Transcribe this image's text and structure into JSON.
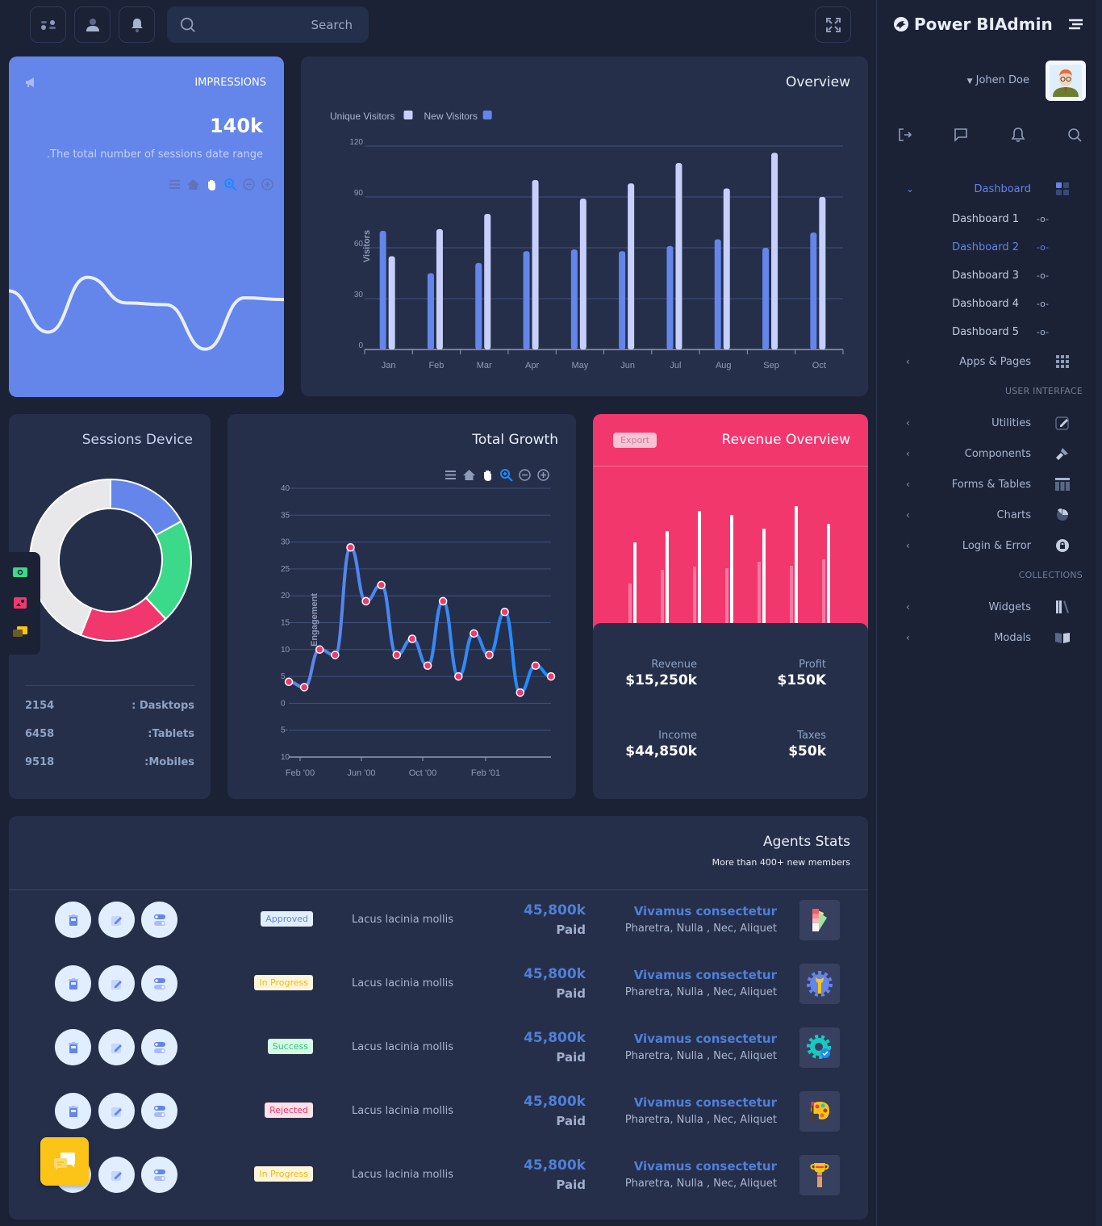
{
  "topbar": {
    "search_placeholder": "Search",
    "icons": [
      "apps-icon",
      "user-icon",
      "bell-icon",
      "search-icon",
      "fullscreen-icon"
    ]
  },
  "impressions": {
    "title": "IMPRESSIONS",
    "value": "140k",
    "subtitle": ".The total number of sessions date range",
    "sparkline": [
      62,
      38,
      70,
      55,
      54,
      28,
      58,
      57
    ]
  },
  "overview": {
    "title": "Overview",
    "chart_data": {
      "type": "bar",
      "title": "Overview",
      "xlabel": "",
      "ylabel": "Visitors",
      "ylim": [
        0,
        120
      ],
      "yticks": [
        0,
        30,
        60,
        90,
        120
      ],
      "legend": "top-left",
      "categories": [
        "Jan",
        "Feb",
        "Mar",
        "Apr",
        "May",
        "Jun",
        "Jul",
        "Aug",
        "Sep",
        "Oct"
      ],
      "series": [
        {
          "name": "New Visitors",
          "color": "#6485ea",
          "values": [
            70,
            45,
            51,
            58,
            59,
            58,
            61,
            65,
            60,
            69
          ]
        },
        {
          "name": "Unique Visitors",
          "color": "#c7d0fb",
          "values": [
            55,
            71,
            80,
            100,
            89,
            98,
            110,
            95,
            116,
            90
          ]
        }
      ],
      "legend_labels": [
        "Unique Visitors",
        "New Visitors"
      ]
    }
  },
  "sessions": {
    "title": "Sessions Device",
    "chart_data": {
      "type": "pie",
      "slices": [
        {
          "name": "Blue",
          "value": 17,
          "color": "#6485ea"
        },
        {
          "name": "Green",
          "value": 21,
          "color": "#3bd98a"
        },
        {
          "name": "Red",
          "value": 18,
          "color": "#f2376d"
        },
        {
          "name": "Grey",
          "value": 44,
          "color": "#e8e8ea"
        }
      ]
    },
    "rows": [
      {
        "value": "2154",
        "label": ": Dasktops"
      },
      {
        "value": "6458",
        "label": ":Tablets"
      },
      {
        "value": "9518",
        "label": ":Mobiles"
      }
    ]
  },
  "growth": {
    "title": "Total Growth",
    "chart_data": {
      "type": "line",
      "title": "Total Growth",
      "ylabel": "Engagement",
      "ylim": [
        -10,
        40
      ],
      "ytick_labels": [
        "40",
        "35",
        "30",
        "25",
        "20",
        "15",
        "10",
        "5",
        "0",
        "5-",
        "10-"
      ],
      "xtick_labels": [
        "Feb '00",
        "Jun '00",
        "Oct '00",
        "Feb '01"
      ],
      "values": [
        4,
        3,
        10,
        9,
        29,
        19,
        22,
        9,
        12,
        7,
        19,
        5,
        13,
        9,
        17,
        2,
        7,
        5
      ],
      "grid": true
    }
  },
  "revenue": {
    "title": "Revenue Overview",
    "export_label": "Export",
    "chart_data": {
      "type": "bar",
      "series": [
        {
          "name": "primary",
          "values": [
            95,
            109,
            134,
            129,
            112,
            140,
            118
          ]
        },
        {
          "name": "secondary",
          "values": [
            44,
            61,
            65,
            63,
            71,
            66,
            74
          ]
        }
      ]
    },
    "stats": [
      {
        "label": "Revenue",
        "value": "$15,250k"
      },
      {
        "label": "Profit",
        "value": "$150K"
      },
      {
        "label": "Income",
        "value": "$44,850k"
      },
      {
        "label": "Taxes",
        "value": "$50k"
      }
    ]
  },
  "agents": {
    "title": "Agents Stats",
    "subtitle": "More than 400+ new members",
    "rows": [
      {
        "status": "Approved",
        "desc": "Lacus lacinia mollis",
        "amount": "45,800k",
        "paid": "Paid",
        "title": "Vivamus consectetur",
        "sub": "Pharetra, Nulla , Nec, Aliquet",
        "thumb": "palette-swatch-icon"
      },
      {
        "status": "In Progress",
        "desc": "Lacus lacinia mollis",
        "amount": "45,800k",
        "paid": "Paid",
        "title": "Vivamus consectetur",
        "sub": "Pharetra, Nulla , Nec, Aliquet",
        "thumb": "gear-wrench-icon"
      },
      {
        "status": "Success",
        "desc": "Lacus lacinia mollis",
        "amount": "45,800k",
        "paid": "Paid",
        "title": "Vivamus consectetur",
        "sub": "Pharetra, Nulla , Nec, Aliquet",
        "thumb": "gear-check-icon"
      },
      {
        "status": "Rejected",
        "desc": "Lacus lacinia mollis",
        "amount": "45,800k",
        "paid": "Paid",
        "title": "Vivamus consectetur",
        "sub": "Pharetra, Nulla , Nec, Aliquet",
        "thumb": "paint-palette-icon"
      },
      {
        "status": "In Progress",
        "desc": "Lacus lacinia mollis",
        "amount": "45,800k",
        "paid": "Paid",
        "title": "Vivamus consectetur",
        "sub": "Pharetra, Nulla , Nec, Aliquet",
        "thumb": "trophy-icon"
      }
    ],
    "status_colors": {
      "Approved": {
        "bg": "#e1eeff",
        "fg": "#6485ea"
      },
      "In Progress": {
        "bg": "#fff5da",
        "fg": "#f4b80f"
      },
      "Success": {
        "bg": "#d6fbe5",
        "fg": "#2ec27a"
      },
      "Rejected": {
        "bg": "#fde1e8",
        "fg": "#f2376d"
      }
    }
  },
  "sidebar": {
    "brand": "Power BIAdmin",
    "user_name": "Johen Doe",
    "dashboard_label": "Dashboard",
    "dashboards": [
      "Dashboard 1",
      "Dashboard 2",
      "Dashboard 3",
      "Dashboard 4",
      "Dashboard 5"
    ],
    "active_dashboard": "Dashboard 2",
    "apps_label": "Apps & Pages",
    "section_ui": "USER INTERFACE",
    "ui_items": [
      "Utilities",
      "Components",
      "Forms & Tables",
      "Charts",
      "Login & Error"
    ],
    "section_collections": "COLLECTIONS",
    "collection_items": [
      "Widgets",
      "Modals"
    ],
    "accent": "#6485ea"
  }
}
